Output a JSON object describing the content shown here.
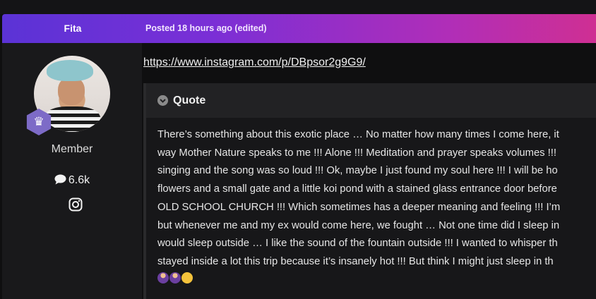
{
  "post": {
    "username": "Fita",
    "posted": "Posted 18 hours ago (edited)",
    "link": "https://www.instagram.com/p/DBpsor2g9G9/"
  },
  "author": {
    "role": "Member",
    "messages": "6.6k",
    "icons": [
      "avatar",
      "crown-badge-icon",
      "comment-icon",
      "instagram-icon"
    ]
  },
  "quote": {
    "title": "Quote",
    "lines": [
      "There’s something about this exotic place … No matter how many times I come here, it",
      "way Mother Nature speaks to me !!! Alone !!! Meditation and prayer speaks volumes !!!",
      "singing and the song was so loud !!! Ok, maybe I just found my soul here !!! I will be ho",
      "flowers and a small gate and a little koi pond with a stained glass entrance door before",
      "OLD SCHOOL CHURCH !!! Which sometimes has a deeper meaning and feeling !!! I’m",
      "but whenever me and my ex would come here, we fought … Not one time did I sleep in",
      "would sleep outside … I like the sound of the fountain outside !!! I wanted to whisper th",
      "stayed inside a lot this trip because it’s insanely hot !!! But think I might just sleep in th"
    ],
    "emojis": [
      "woman-shrugging-emoji",
      "woman-shrugging-emoji",
      "smiling-face-emoji"
    ]
  },
  "colors": {
    "header_gradient_start": "#5b33d6",
    "header_gradient_end": "#cf2f93",
    "badge": "#7d6bc7"
  }
}
